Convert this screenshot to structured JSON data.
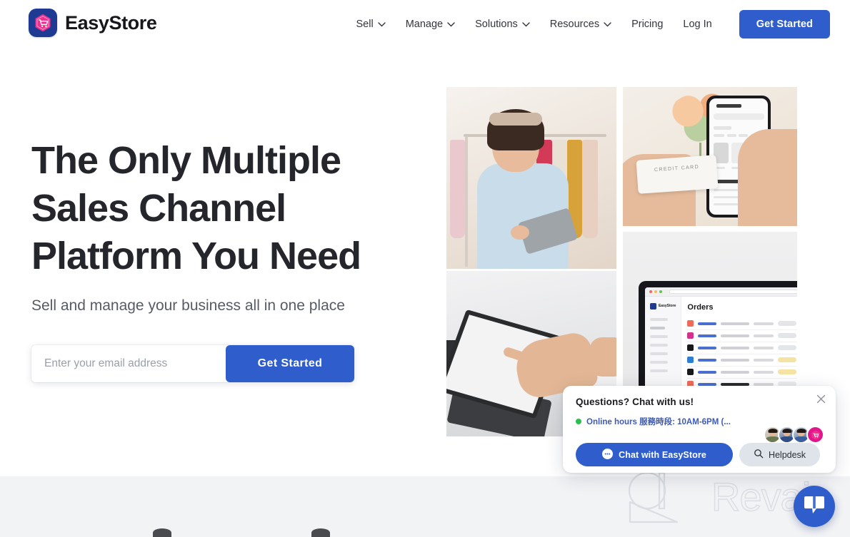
{
  "brand": {
    "name": "EasyStore",
    "logo_icon": "easystore-cart-hexagon-logo",
    "logo_bg": "#1f3a93",
    "logo_accent": "#f0308f"
  },
  "nav": {
    "items": [
      {
        "label": "Sell",
        "has_dropdown": true
      },
      {
        "label": "Manage",
        "has_dropdown": true
      },
      {
        "label": "Solutions",
        "has_dropdown": true
      },
      {
        "label": "Resources",
        "has_dropdown": true
      },
      {
        "label": "Pricing",
        "has_dropdown": false
      },
      {
        "label": "Log In",
        "has_dropdown": false
      }
    ],
    "cta_label": "Get Started",
    "cta_color": "#2f5ecc"
  },
  "hero": {
    "headline_line1": "The Only Multiple",
    "headline_line2": "Sales Channel",
    "headline_line3": "Platform You Need",
    "subhead": "Sell and manage your business all in one place",
    "email_placeholder": "Enter your email address",
    "email_value": "",
    "form_cta_label": "Get Started"
  },
  "photos": [
    {
      "alt": "Woman browsing clothing rack with tablet"
    },
    {
      "alt": "Hand holding credit card and smartphone storefront"
    },
    {
      "alt": "Hand using POS touchscreen terminal"
    },
    {
      "alt": "Laptop showing EasyStore Orders dashboard"
    }
  ],
  "dashboard": {
    "brand_label": "EasyStore",
    "page_title": "Orders",
    "status_pill_colors": [
      "#e3e5e8",
      "#e3e5e8",
      "#e3e5e8",
      "#f5e3a4",
      "#f5e3a4",
      "#ebebee",
      "#ebebee",
      "#ebebee"
    ],
    "channel_colors": [
      "#f06a5a",
      "#d4318c",
      "#18181b",
      "#2e7fd4",
      "#18181b",
      "#f06a5a",
      "#f06a5a",
      "#e0556b"
    ]
  },
  "chat": {
    "title": "Questions? Chat with us!",
    "status": "Online hours 服務時段: 10AM-6PM (...",
    "status_color": "#3d5ab5",
    "dot_color": "#2bbf4e",
    "chat_button_label": "Chat with EasyStore",
    "helpdesk_button_label": "Helpdesk",
    "close_icon": "close-icon",
    "chat_icon": "chat-bubble-icon",
    "search_icon": "search-icon",
    "avatars": [
      {
        "name": "agent-1"
      },
      {
        "name": "agent-2"
      },
      {
        "name": "agent-3"
      },
      {
        "name": "easystore-logo-avatar"
      }
    ]
  },
  "fab": {
    "icon": "chat-bubble-icon",
    "color": "#2f5ecc"
  },
  "watermark": {
    "text": "Revain",
    "logo_icon": "revain-q-logo"
  }
}
